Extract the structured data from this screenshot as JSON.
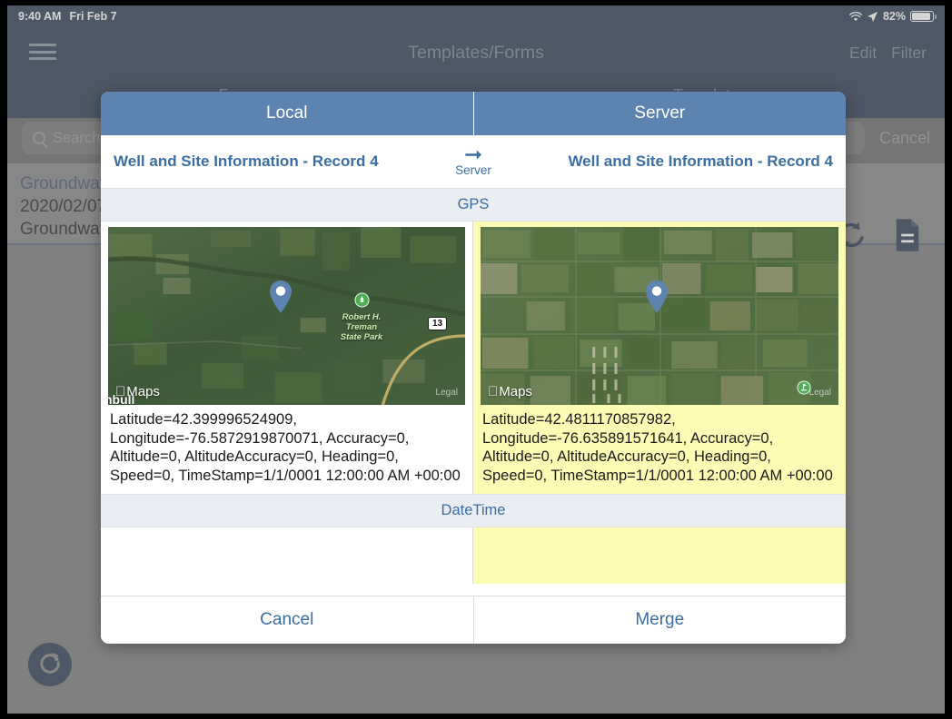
{
  "status_bar": {
    "time": "9:40 AM",
    "date": "Fri Feb 7",
    "battery_percent": "82%",
    "wifi_icon": "wifi-icon",
    "location_icon": "location-arrow-icon",
    "battery_icon": "battery-icon"
  },
  "nav_bar": {
    "menu_icon": "hamburger-menu-icon",
    "title": "Templates/Forms",
    "edit_label": "Edit",
    "filter_label": "Filter"
  },
  "segmented_tabs": [
    {
      "label": "Forms"
    },
    {
      "label": "Templates"
    }
  ],
  "search": {
    "placeholder": "Search b",
    "search_icon": "search-icon",
    "cancel_label": "Cancel"
  },
  "list": {
    "row": {
      "title": "Groundwat",
      "line2": "2020/02/07",
      "line3": "Groundwate"
    },
    "sync_icon": "sync-refresh-icon",
    "document_icon": "document-icon"
  },
  "fab": {
    "refresh_icon": "refresh-circle-icon"
  },
  "modal": {
    "header": {
      "left_label": "Local",
      "right_label": "Server"
    },
    "record": {
      "left_title": "Well and Site Information - Record 4",
      "right_title": "Well and Site Information - Record 4",
      "direction_icon": "arrow-right-icon",
      "direction_label": "Server"
    },
    "sections": [
      {
        "name": "GPS",
        "left": {
          "map": {
            "attribution": "Maps",
            "legal": "Legal",
            "apple_icon": "apple-logo-icon",
            "pin_icon": "map-pin-icon",
            "place_label": "Robert H.\nTreman\nState Park",
            "road_shield": "13",
            "partial_place_label": "nbull"
          },
          "value": "Latitude=42.399996524909, Longitude=-76.5872919870071, Accuracy=0, Altitude=0, AltitudeAccuracy=0, Heading=0, Speed=0, TimeStamp=1/1/0001 12:00:00 AM +00:00",
          "highlighted": false
        },
        "right": {
          "map": {
            "attribution": "Maps",
            "legal": "Legal",
            "apple_icon": "apple-logo-icon",
            "pin_icon": "map-pin-icon"
          },
          "value": "Latitude=42.4811170857982, Longitude=-76.635891571641, Accuracy=0, Altitude=0, AltitudeAccuracy=0, Heading=0, Speed=0, TimeStamp=1/1/0001 12:00:00 AM +00:00",
          "highlighted": true
        }
      },
      {
        "name": "DateTime",
        "left": {
          "value": "",
          "highlighted": false
        },
        "right": {
          "value": "",
          "highlighted": true
        }
      }
    ],
    "footer": {
      "cancel_label": "Cancel",
      "merge_label": "Merge"
    }
  },
  "colors": {
    "navbar": "#344258",
    "modal_header_blue": "#5d83b0",
    "accent_link": "#3a6ea5",
    "highlight_yellow": "#fcfcb4",
    "section_header_gray": "#eaedf1",
    "backdrop_gray": "#808080"
  }
}
